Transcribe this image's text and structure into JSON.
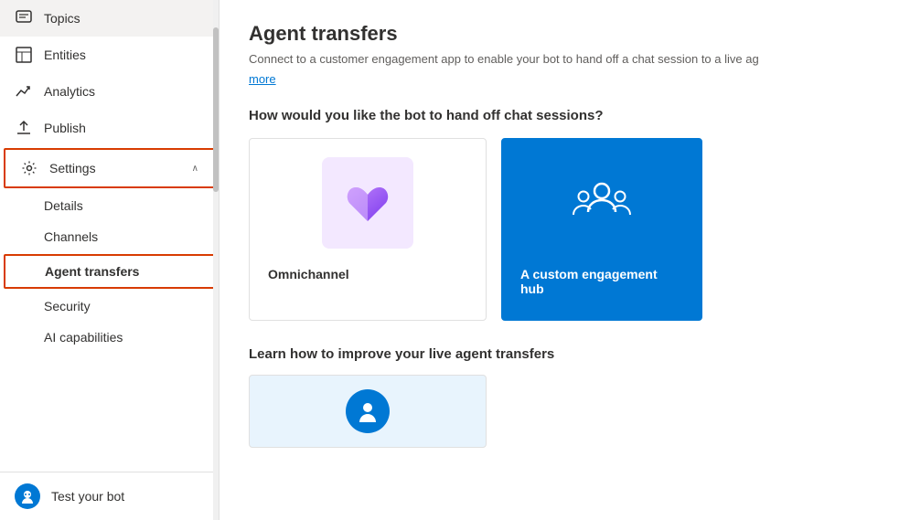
{
  "sidebar": {
    "items": [
      {
        "id": "topics",
        "label": "Topics",
        "icon": "chat-icon"
      },
      {
        "id": "entities",
        "label": "Entities",
        "icon": "table-icon"
      },
      {
        "id": "analytics",
        "label": "Analytics",
        "icon": "analytics-icon"
      },
      {
        "id": "publish",
        "label": "Publish",
        "icon": "publish-icon"
      },
      {
        "id": "settings",
        "label": "Settings",
        "icon": "settings-icon",
        "expanded": true
      }
    ],
    "sub_items": [
      {
        "id": "details",
        "label": "Details"
      },
      {
        "id": "channels",
        "label": "Channels"
      },
      {
        "id": "agent-transfers",
        "label": "Agent transfers",
        "active": true
      },
      {
        "id": "security",
        "label": "Security"
      },
      {
        "id": "ai-capabilities",
        "label": "AI capabilities"
      }
    ],
    "bottom": {
      "label": "Test your bot",
      "icon": "bot-icon"
    }
  },
  "main": {
    "title": "Agent transfers",
    "subtitle": "Connect to a customer engagement app to enable your bot to hand off a chat session to a live ag",
    "link": "more",
    "section_question": "How would you like the bot to hand off chat sessions?",
    "cards": [
      {
        "id": "omnichannel",
        "label": "Omnichannel"
      },
      {
        "id": "custom-hub",
        "label": "A custom engagement hub"
      }
    ],
    "learn_section": "Learn how to improve your live agent transfers"
  }
}
